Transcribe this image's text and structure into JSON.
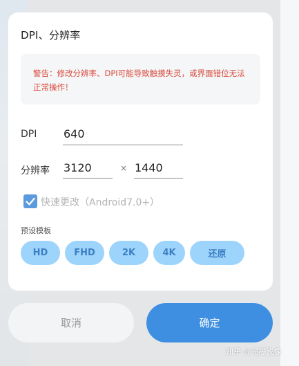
{
  "dialog": {
    "title": "DPI、分辨率",
    "warning": "警告：修改分辨率、DPI可能导致触摸失灵，或界面错位无法正常操作！",
    "dpi": {
      "label": "DPI",
      "value": "640"
    },
    "resolution": {
      "label": "分辨率",
      "width": "3120",
      "times": "×",
      "height": "1440"
    },
    "quick_change": {
      "label": "快速更改（Android7.0+）",
      "checked": true
    },
    "presets": {
      "label": "预设模板",
      "items": [
        "HD",
        "FHD",
        "2K",
        "4K",
        "还原"
      ]
    }
  },
  "buttons": {
    "cancel": "取消",
    "ok": "确定"
  },
  "watermark": "知乎 @光栅锐像",
  "colors": {
    "accent": "#3e8fe1",
    "warning": "#d84a3c",
    "preset_bg": "#9dd4fb"
  }
}
